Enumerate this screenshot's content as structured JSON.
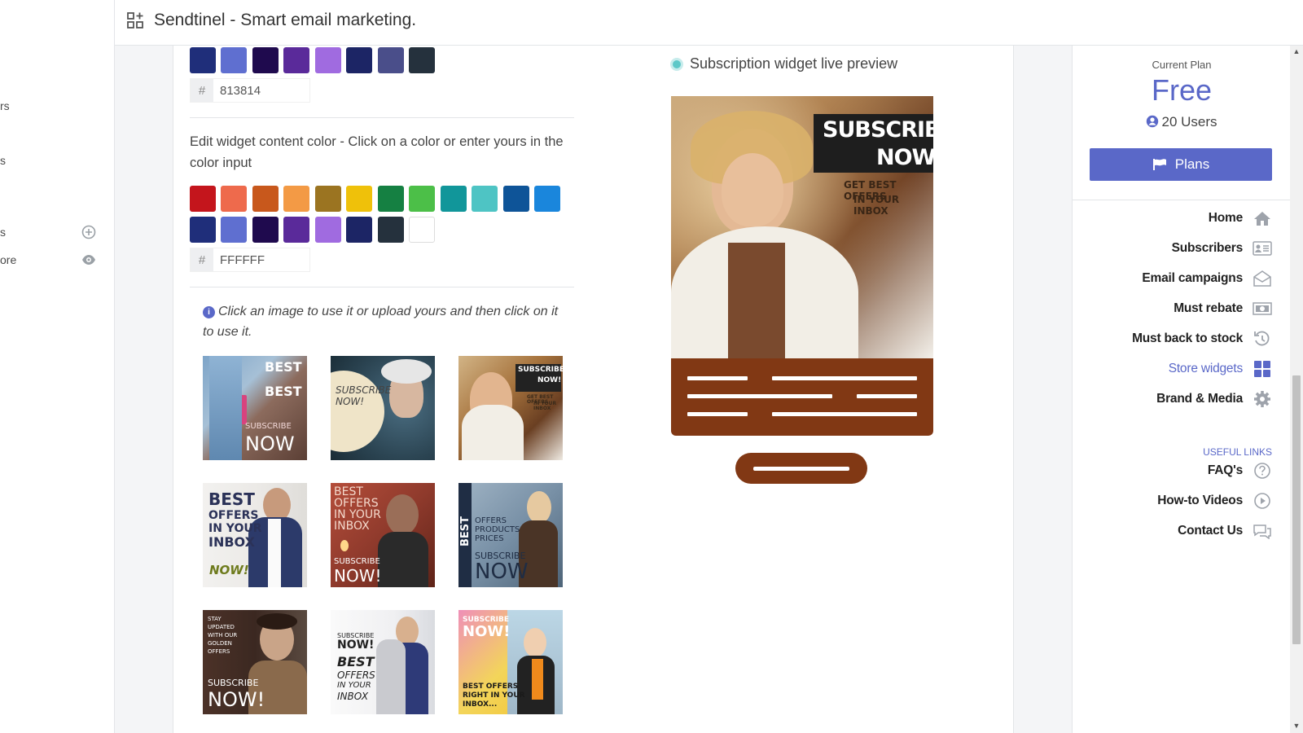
{
  "app": {
    "title": "Sendtinel - Smart email marketing."
  },
  "left_sidebar": {
    "items": [
      {
        "label": "rs"
      },
      {
        "label": "s"
      },
      {
        "label": "s"
      },
      {
        "label": "ore"
      }
    ]
  },
  "bg_color": {
    "swatches": [
      "#1f2e7a",
      "#5f6fd0",
      "#1f0a4e",
      "#5a2a9a",
      "#a06be0",
      "#1c2565",
      "#4a4e8a",
      "#25313d"
    ],
    "hex_value": "813814"
  },
  "content_color": {
    "label": "Edit widget content color - Click on a color or enter yours in the color input",
    "swatches_row1": [
      "#c4151c",
      "#ee6a4c",
      "#c8581c",
      "#f39a45",
      "#9b7421",
      "#efc10a",
      "#158042",
      "#4cbf48",
      "#11969a",
      "#4ec4c4",
      "#0e5498",
      "#1a86dc"
    ],
    "swatches_row2": [
      "#1f2e7a",
      "#5f6fd0",
      "#1f0a4e",
      "#5a2a9a",
      "#a06be0",
      "#1c2565",
      "#25313d",
      "#ffffff"
    ],
    "hex_value": "FFFFFF"
  },
  "images": {
    "instruction": "Click an image to use it or upload yours and then click on it to use it.",
    "thumbnails": [
      {
        "texts": [
          "BEST",
          "BEST",
          "SUBSCRIBE",
          "NOW"
        ]
      },
      {
        "texts": [
          "SUBSCRIBE",
          "NOW!"
        ]
      },
      {
        "texts": [
          "SUBSCRIBE",
          "NOW!",
          "GET BEST OFFERS",
          "IN YOUR INBOX"
        ]
      },
      {
        "texts": [
          "BEST",
          "OFFERS",
          "IN YOUR",
          "INBOX",
          "NOW!"
        ]
      },
      {
        "texts": [
          "BEST",
          "OFFERS",
          "IN YOUR",
          "INBOX",
          "SUBSCRIBE",
          "NOW!"
        ]
      },
      {
        "texts": [
          "BEST",
          "OFFERS",
          "PRODUCTS",
          "PRICES",
          "SUBSCRIBE",
          "NOW"
        ]
      },
      {
        "texts": [
          "STAY",
          "UPDATED",
          "WITH OUR",
          "GOLDEN",
          "OFFERS",
          "SUBSCRIBE",
          "NOW!"
        ]
      },
      {
        "texts": [
          "SUBSCRIBE",
          "NOW!",
          "BEST",
          "OFFERS",
          "IN YOUR",
          "INBOX"
        ]
      },
      {
        "texts": [
          "SUBSCRIBE",
          "NOW!",
          "BEST OFFERS",
          "RIGHT IN YOUR",
          "INBOX..."
        ]
      }
    ]
  },
  "preview": {
    "title": "Subscription widget live preview",
    "headline1": "SUBSCRIBE",
    "headline2": "NOW!",
    "sub1": "GET BEST OFFERS",
    "sub2": "IN YOUR INBOX",
    "content_color": "#813814"
  },
  "plan": {
    "label": "Current Plan",
    "name": "Free",
    "users": "20 Users",
    "button": "Plans"
  },
  "nav": {
    "home": "Home",
    "subscribers": "Subscribers",
    "email_campaigns": "Email campaigns",
    "must_rebate": "Must rebate",
    "must_back": "Must back to stock",
    "store_widgets": "Store widgets",
    "brand_media": "Brand & Media",
    "useful_links": "USEFUL LINKS",
    "faqs": "FAQ's",
    "howto": "How-to Videos",
    "contact": "Contact Us"
  },
  "colors": {
    "accent": "#5a68c8"
  }
}
